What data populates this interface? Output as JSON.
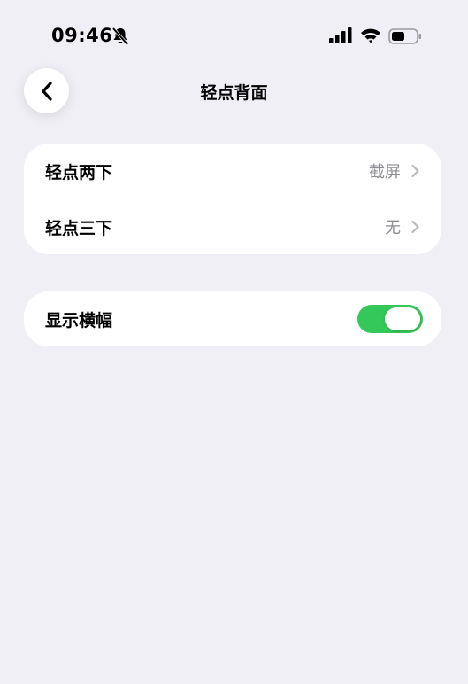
{
  "status_bar": {
    "time": "09:46",
    "icons": [
      "bell-slash-icon",
      "cellular-signal-icon",
      "wifi-icon",
      "battery-icon"
    ]
  },
  "nav": {
    "title": "轻点背面",
    "back_icon": "chevron-left-icon"
  },
  "groups": [
    {
      "rows": [
        {
          "label": "轻点两下",
          "value": "截屏"
        },
        {
          "label": "轻点三下",
          "value": "无"
        }
      ]
    },
    {
      "rows": [
        {
          "label": "显示横幅",
          "toggle_on": true
        }
      ]
    }
  ],
  "colors": {
    "background": "#f0eff5",
    "toggle_on": "#34c759",
    "secondary_text": "#8e8e93"
  }
}
